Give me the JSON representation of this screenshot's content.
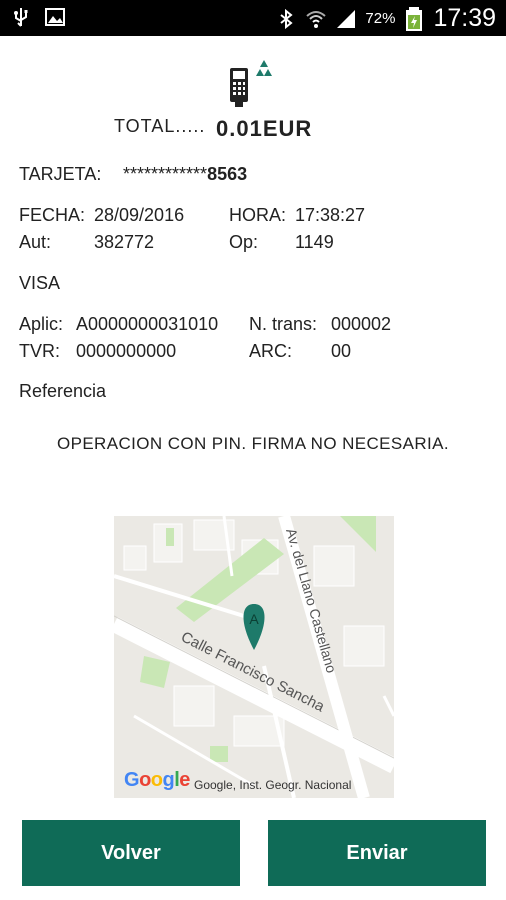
{
  "status_bar": {
    "battery_percent": "72%",
    "time": "17:39",
    "icons": [
      "usb-icon",
      "image-icon",
      "bluetooth-icon",
      "wifi-icon",
      "signal-icon",
      "battery-icon"
    ]
  },
  "receipt": {
    "total_label": "TOTAL.....",
    "total_value": "0.01EUR",
    "tarjeta_label": "TARJETA:",
    "tarjeta_mask": "************",
    "tarjeta_last": "8563",
    "fecha_label": "FECHA:",
    "fecha_value": "28/09/2016",
    "hora_label": "HORA:",
    "hora_value": "17:38:27",
    "aut_label": "Aut:",
    "aut_value": "382772",
    "op_label": "Op:",
    "op_value": "1149",
    "brand": "VISA",
    "aplic_label": "Aplic:",
    "aplic_value": "A0000000031010",
    "ntrans_label": "N. trans:",
    "ntrans_value": "000002",
    "tvr_label": "TVR:",
    "tvr_value": "0000000000",
    "arc_label": "ARC:",
    "arc_value": "00",
    "referencia_label": "Referencia",
    "pin_message": "OPERACION CON PIN. FIRMA NO NECESARIA."
  },
  "map": {
    "street1": "Calle Francisco Sancha",
    "street2": "Av. del Llano Castellano",
    "marker_label": "A",
    "logo": "Google",
    "attribution": "Google, Inst. Geogr. Nacional"
  },
  "buttons": {
    "volver": "Volver",
    "enviar": "Enviar"
  },
  "colors": {
    "accent": "#0f6b57",
    "marker": "#1e7a6a"
  }
}
